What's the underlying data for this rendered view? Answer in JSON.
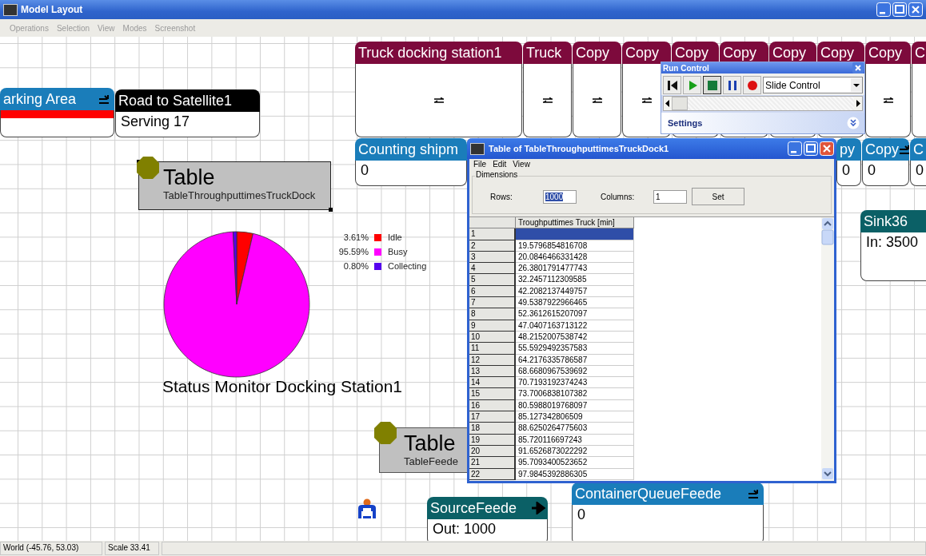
{
  "window": {
    "title": "Model Layout",
    "menu": [
      {
        "label": "Operations",
        "disabled": true
      },
      {
        "label": "Selection",
        "disabled": true
      },
      {
        "label": "View",
        "disabled": true
      },
      {
        "label": "Modes",
        "disabled": true
      },
      {
        "label": "Screenshot",
        "disabled": true
      }
    ]
  },
  "canvas": {
    "nodes": [
      {
        "kind": "queue",
        "header": "arking Area",
        "color": "#1a7dba"
      },
      {
        "kind": "display",
        "header": "Road to Satellite1",
        "color": "#000000",
        "text": "Serving 17"
      },
      {
        "kind": "processor",
        "header": "Truck docking station1",
        "color": "#7d0a3c"
      },
      {
        "kind": "processor",
        "header": "Truck",
        "color": "#7d0a3c"
      },
      {
        "kind": "processor",
        "header": "Copy",
        "color": "#7d0a3c"
      },
      {
        "kind": "processor",
        "header": "Copy",
        "color": "#7d0a3c"
      },
      {
        "kind": "processor",
        "header": "Copy",
        "color": "#7d0a3c"
      },
      {
        "kind": "processor",
        "header": "Copy",
        "color": "#7d0a3c"
      },
      {
        "kind": "processor",
        "header": "Copy",
        "color": "#7d0a3c"
      },
      {
        "kind": "processor",
        "header": "Copy",
        "color": "#7d0a3c"
      },
      {
        "kind": "processor",
        "header": "Copy",
        "color": "#7d0a3c"
      },
      {
        "kind": "processor",
        "header": "C",
        "color": "#7d0a3c"
      },
      {
        "kind": "display",
        "header": "Counting shipm",
        "color": "#1a7dba",
        "text": "0"
      },
      {
        "kind": "display",
        "header": "py",
        "color": "#1a7dba",
        "text": "0"
      },
      {
        "kind": "display",
        "header": "Copy",
        "color": "#1a7dba",
        "text": "0"
      },
      {
        "kind": "display",
        "header": "C",
        "color": "#1a7dba",
        "text": "0"
      },
      {
        "kind": "display",
        "header": "Sink36",
        "color": "#0b6066",
        "text": "In: 3500"
      },
      {
        "kind": "display",
        "header": "SourceFeede",
        "color": "#0b6066",
        "text": "Out: 1000"
      },
      {
        "kind": "display",
        "header": "ContainerQueueFeede",
        "color": "#1a7dba",
        "text": "0"
      }
    ],
    "tables": [
      {
        "title": "Table",
        "subtitle": "TableThroughputtimesTruckDock",
        "selected": true
      },
      {
        "title": "Table",
        "subtitle": "TableFeede",
        "selected": false
      }
    ],
    "status_monitor": {
      "chart_data": {
        "type": "pie",
        "title": "Status Monitor Docking Station1",
        "categories": [
          "Idle",
          "Busy",
          "Collecting"
        ],
        "values": [
          3.61,
          95.59,
          0.8
        ],
        "colors": [
          "#ff0000",
          "#ff00ff",
          "#5500ee"
        ],
        "value_labels": [
          "3.61%",
          "95.59%",
          "0.80%"
        ],
        "legend": "right"
      }
    }
  },
  "table_window": {
    "title": "Table of TableThroughputtimesTruckDock1",
    "menu": [
      "File",
      "Edit",
      "View"
    ],
    "group": "Dimensions",
    "rows_field": {
      "label": "Rows:",
      "value": "1000",
      "selected": true
    },
    "columns_field": {
      "label": "Columns:",
      "value": "1",
      "selected": false
    },
    "set_button": "Set",
    "column": "Troughputtimes Truck [min]",
    "rows": [
      {
        "index": "1",
        "selected": true
      },
      {
        "index": "2",
        "value": "19.5796854816708",
        "selected": false
      },
      {
        "index": "3",
        "value": "20.0846466331428",
        "selected": false
      },
      {
        "index": "4",
        "value": "26.3801791477743",
        "selected": false
      },
      {
        "index": "5",
        "value": "32.2457112309585",
        "selected": false
      },
      {
        "index": "6",
        "value": "42.2082137449757",
        "selected": false
      },
      {
        "index": "7",
        "value": "49.5387922966465",
        "selected": false
      },
      {
        "index": "8",
        "value": "52.3612615207097",
        "selected": false
      },
      {
        "index": "9",
        "value": "47.0407163713122",
        "selected": false
      },
      {
        "index": "10",
        "value": "48.2152007538742",
        "selected": false
      },
      {
        "index": "11",
        "value": "55.5929492357583",
        "selected": false
      },
      {
        "index": "12",
        "value": "64.2176335786587",
        "selected": false
      },
      {
        "index": "13",
        "value": "68.6680967539692",
        "selected": false
      },
      {
        "index": "14",
        "value": "70.7193192374243",
        "selected": false
      },
      {
        "index": "15",
        "value": "73.7006838107382",
        "selected": false
      },
      {
        "index": "16",
        "value": "80.5988019768097",
        "selected": false
      },
      {
        "index": "17",
        "value": "85.127342806509",
        "selected": false
      },
      {
        "index": "18",
        "value": "88.6250264775603",
        "selected": false
      },
      {
        "index": "19",
        "value": "85.720116697243",
        "selected": false
      },
      {
        "index": "20",
        "value": "91.6526873022292",
        "selected": false
      },
      {
        "index": "21",
        "value": "95.7093400523652",
        "selected": false
      },
      {
        "index": "22",
        "value": "97.9845392886305",
        "selected": false
      }
    ]
  },
  "run_control": {
    "title": "Run Control",
    "buttons": [
      {
        "kind": "reset",
        "pressed": false
      },
      {
        "kind": "run",
        "pressed": false
      },
      {
        "kind": "stop",
        "pressed": true
      },
      {
        "kind": "pause",
        "pressed": false
      },
      {
        "kind": "record",
        "pressed": false
      }
    ],
    "mode": "Slide Control",
    "slider": {
      "level": 0
    },
    "settings": "Settings"
  },
  "status_bar": [
    "World (-45.76, 53.03)",
    "Scale 33.41"
  ]
}
